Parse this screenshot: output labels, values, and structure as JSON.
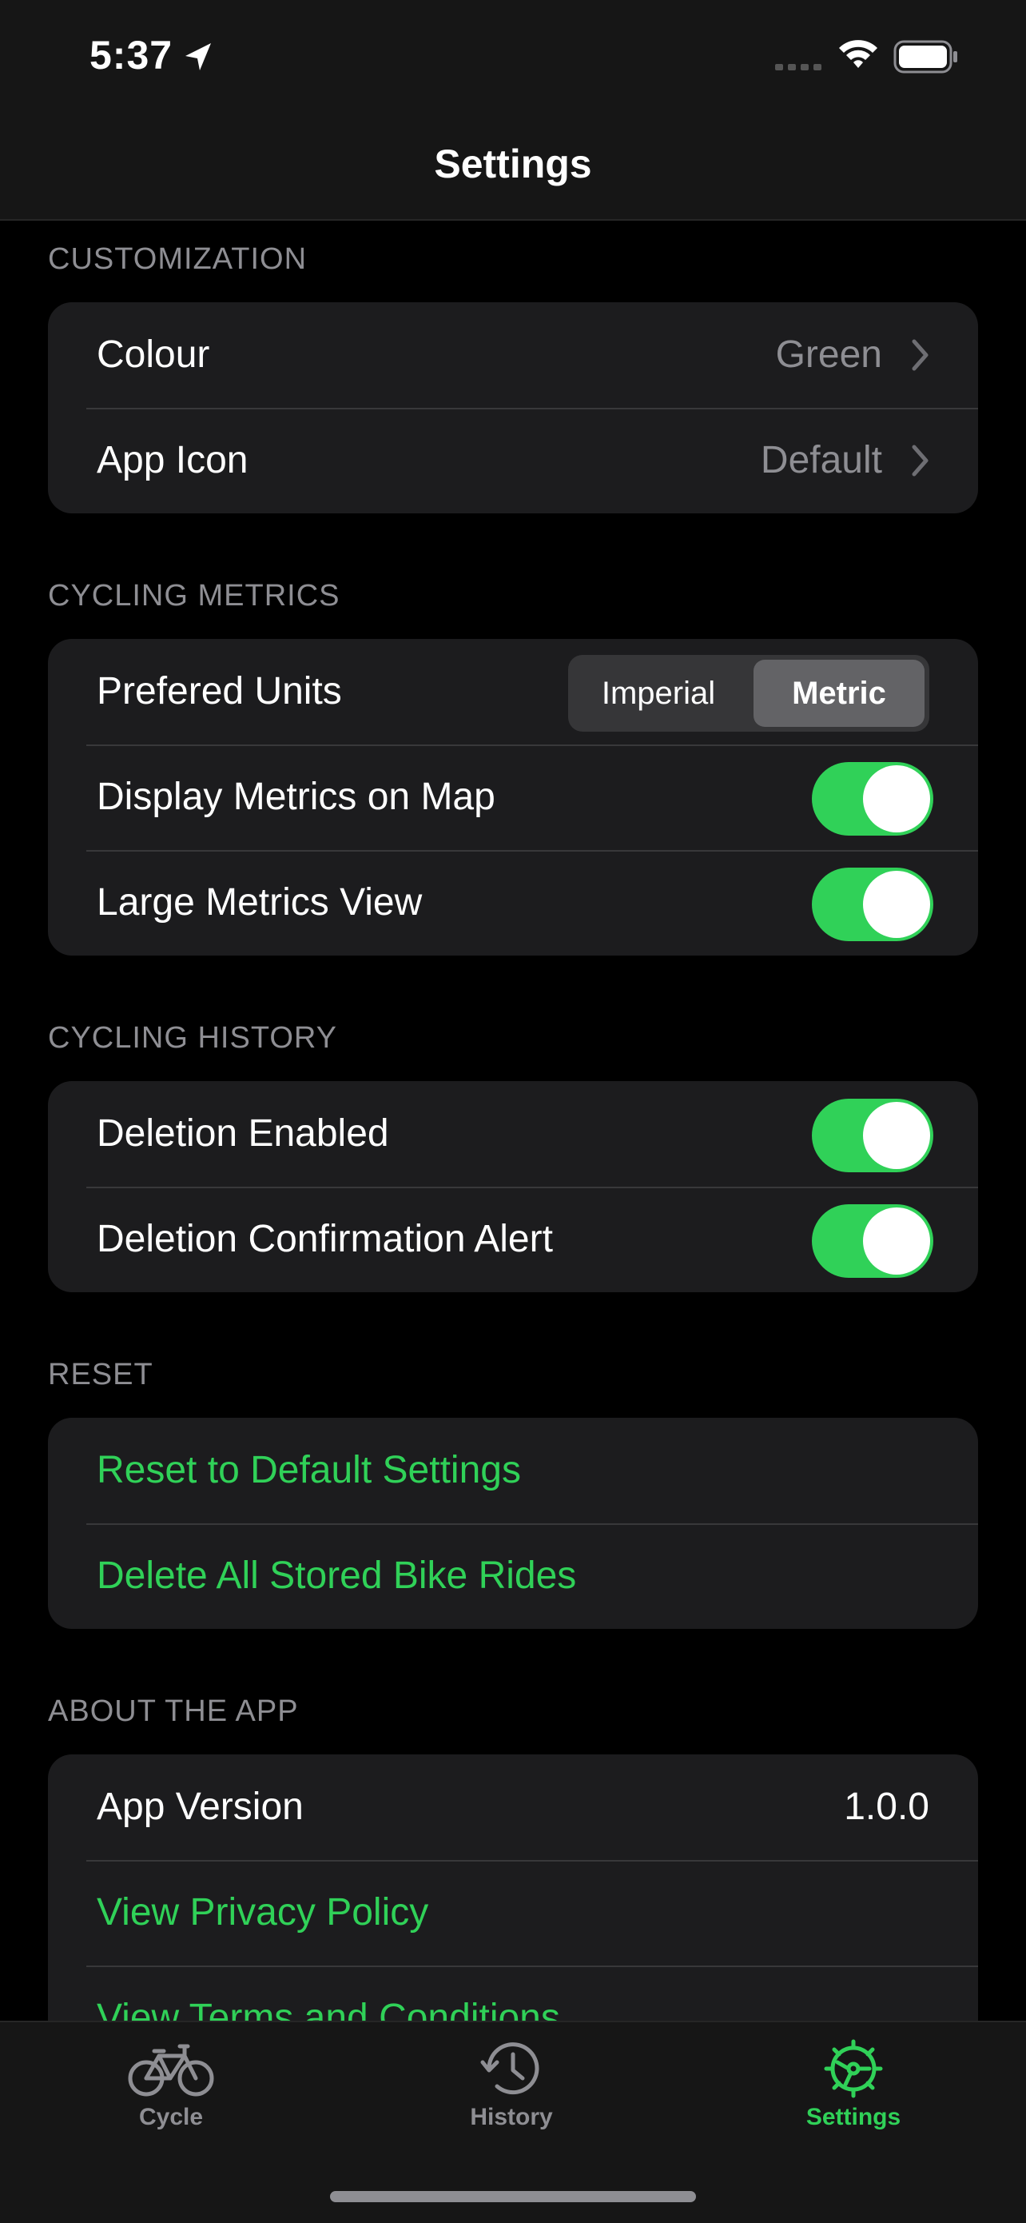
{
  "status": {
    "time": "5:37"
  },
  "nav": {
    "title": "Settings"
  },
  "colors": {
    "accent": "#30d158",
    "background": "#000000",
    "cell": "#1c1c1e",
    "secondary_text": "#8e8e93"
  },
  "sections": {
    "customization": {
      "header": "CUSTOMIZATION",
      "colour_label": "Colour",
      "colour_value": "Green",
      "app_icon_label": "App Icon",
      "app_icon_value": "Default"
    },
    "metrics": {
      "header": "CYCLING METRICS",
      "units_label": "Prefered Units",
      "units_options": [
        "Imperial",
        "Metric"
      ],
      "units_selected": "Metric",
      "map_label": "Display Metrics on Map",
      "map_on": true,
      "large_label": "Large Metrics View",
      "large_on": true
    },
    "history": {
      "header": "CYCLING HISTORY",
      "deletion_label": "Deletion Enabled",
      "deletion_on": true,
      "confirm_label": "Deletion Confirmation Alert",
      "confirm_on": true
    },
    "reset": {
      "header": "RESET",
      "reset_label": "Reset to Default Settings",
      "delete_label": "Delete All Stored Bike Rides"
    },
    "about": {
      "header": "ABOUT THE APP",
      "version_label": "App Version",
      "version_value": "1.0.0",
      "privacy_label": "View Privacy Policy",
      "terms_label": "View Terms and Conditions"
    }
  },
  "tabs": [
    {
      "label": "Cycle",
      "icon": "bicycle-icon",
      "active": false
    },
    {
      "label": "History",
      "icon": "history-clock-icon",
      "active": false
    },
    {
      "label": "Settings",
      "icon": "gear-icon",
      "active": true
    }
  ]
}
